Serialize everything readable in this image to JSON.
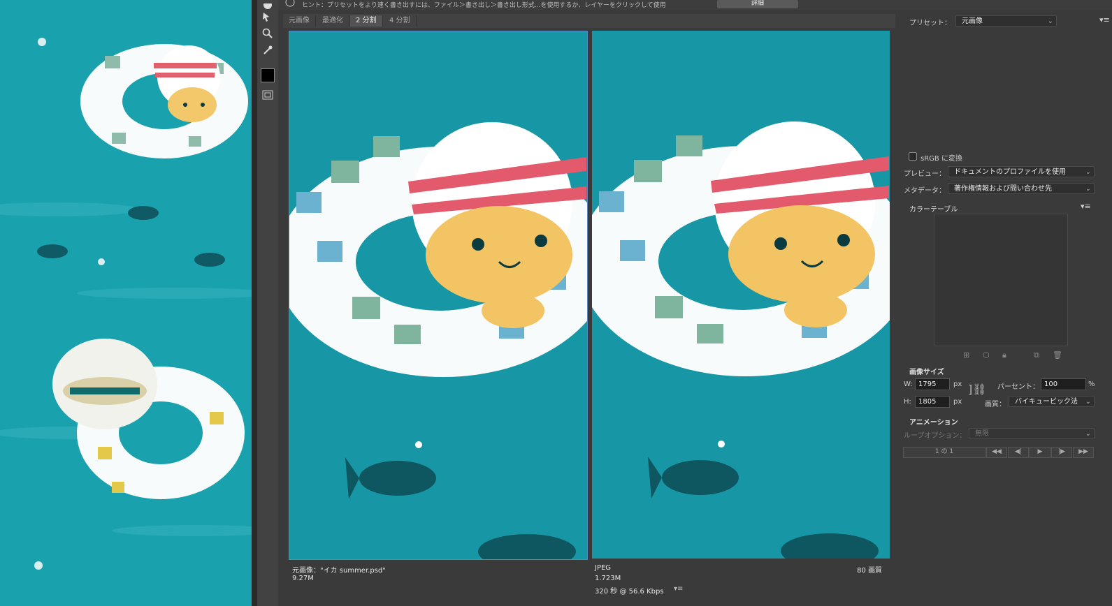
{
  "hint": {
    "text": "ヒント：プリセットをより速く書き出すには、ファイル＞書き出し＞書き出し形式...を使用するか、レイヤーをクリックして使用"
  },
  "detail_button": "詳細",
  "tabs": [
    {
      "label": "元画像",
      "active": false
    },
    {
      "label": "最適化",
      "active": false
    },
    {
      "label": "2 分割",
      "active": true
    },
    {
      "label": "4 分割",
      "active": false
    }
  ],
  "left_pane": {
    "title": "元画像：\"イカ summer.psd\"",
    "size": "9.27M"
  },
  "right_pane": {
    "format": "JPEG",
    "quality": "80 画質",
    "size": "1.723M",
    "time": "320 秒 @ 56.6 Kbps"
  },
  "panel": {
    "preset_label": "プリセット：",
    "preset_value": "元画像",
    "srgb_label": "sRGB に変換",
    "preview_label": "プレビュー：",
    "preview_value": "ドキュメントのプロファイルを使用",
    "metadata_label": "メタデータ：",
    "metadata_value": "著作権情報および問い合わせ先",
    "color_table_label": "カラーテーブル",
    "image_size_label": "画像サイズ",
    "w_label": "W:",
    "w_value": "1795",
    "h_label": "H:",
    "h_value": "1805",
    "px": "px",
    "percent_label": "パーセント：",
    "percent_value": "100",
    "percent_unit": "%",
    "quality_label": "画質：",
    "quality_value": "バイキュービック法",
    "animation_label": "アニメーション",
    "loop_label": "ループオプション：",
    "loop_value": "無限",
    "frame_counter": "1 の 1"
  },
  "colors": {
    "accent": "#5a87c8",
    "water": "#1797a5",
    "panel": "#3a3a3a"
  }
}
